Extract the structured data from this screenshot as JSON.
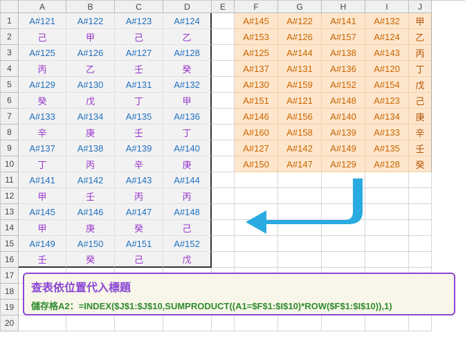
{
  "columns": [
    "A",
    "B",
    "C",
    "D",
    "E",
    "F",
    "G",
    "H",
    "I",
    "J"
  ],
  "left": {
    "codes": [
      [
        "A#121",
        "A#122",
        "A#123",
        "A#124"
      ],
      [
        "A#125",
        "A#126",
        "A#127",
        "A#128"
      ],
      [
        "A#129",
        "A#130",
        "A#131",
        "A#132"
      ],
      [
        "A#133",
        "A#134",
        "A#135",
        "A#136"
      ],
      [
        "A#137",
        "A#138",
        "A#139",
        "A#140"
      ],
      [
        "A#141",
        "A#142",
        "A#143",
        "A#144"
      ],
      [
        "A#145",
        "A#146",
        "A#147",
        "A#148"
      ],
      [
        "A#149",
        "A#150",
        "A#151",
        "A#152"
      ]
    ],
    "chars": [
      [
        "己",
        "甲",
        "己",
        "乙"
      ],
      [
        "丙",
        "乙",
        "壬",
        "癸"
      ],
      [
        "癸",
        "戊",
        "丁",
        "甲"
      ],
      [
        "辛",
        "庚",
        "壬",
        "丁"
      ],
      [
        "丁",
        "丙",
        "辛",
        "庚"
      ],
      [
        "甲",
        "壬",
        "丙",
        "丙"
      ],
      [
        "甲",
        "庚",
        "癸",
        "己"
      ],
      [
        "壬",
        "癸",
        "己",
        "戊"
      ]
    ]
  },
  "right": {
    "codes": [
      [
        "A#145",
        "A#122",
        "A#141",
        "A#132"
      ],
      [
        "A#153",
        "A#126",
        "A#157",
        "A#124"
      ],
      [
        "A#125",
        "A#144",
        "A#138",
        "A#143"
      ],
      [
        "A#137",
        "A#131",
        "A#136",
        "A#120"
      ],
      [
        "A#130",
        "A#159",
        "A#152",
        "A#154"
      ],
      [
        "A#151",
        "A#121",
        "A#148",
        "A#123"
      ],
      [
        "A#146",
        "A#156",
        "A#140",
        "A#134"
      ],
      [
        "A#160",
        "A#158",
        "A#139",
        "A#133"
      ],
      [
        "A#127",
        "A#142",
        "A#149",
        "A#135"
      ],
      [
        "A#150",
        "A#147",
        "A#129",
        "A#128"
      ]
    ],
    "chars": [
      "甲",
      "乙",
      "丙",
      "丁",
      "戊",
      "己",
      "庚",
      "辛",
      "壬",
      "癸"
    ]
  },
  "formula": {
    "title": "查表依位置代入標題",
    "text": "儲存格A2：=INDEX($J$1:$J$10,SUMPRODUCT((A1=$F$1:$I$10)*ROW($F$1:$I$10)),1)"
  }
}
